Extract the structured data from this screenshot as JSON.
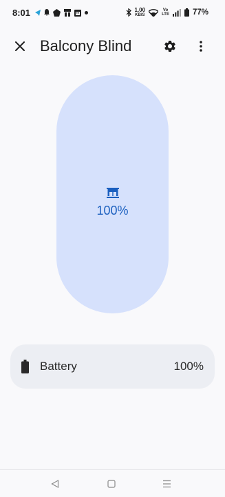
{
  "status_bar": {
    "time": "8:01",
    "net_speed_value": "1.00",
    "net_speed_unit": "KB/S",
    "volte_top": "Vo",
    "volte_bottom": "LTE",
    "battery_percent": "77%",
    "left_icons": [
      "telegram-icon",
      "notification-bell-icon",
      "app-icon",
      "app-icon",
      "calendar-icon",
      "dot-icon"
    ],
    "right_icons": [
      "bluetooth-icon",
      "wifi-icon",
      "signal-icon",
      "battery-icon"
    ]
  },
  "app_bar": {
    "title": "Balcony Blind",
    "close_icon": "close-icon",
    "settings_icon": "gear-icon",
    "more_icon": "more-vert-icon"
  },
  "blind": {
    "level_text": "100%",
    "level_fraction": 1.0,
    "icon": "blind-icon",
    "accent_color": "#1b5fbf",
    "fill_color": "#d6e1fc"
  },
  "battery": {
    "label": "Battery",
    "value": "100%",
    "icon": "battery-full-icon"
  },
  "nav": {
    "back_icon": "back-icon",
    "home_icon": "home-icon",
    "recents_icon": "recents-icon"
  }
}
